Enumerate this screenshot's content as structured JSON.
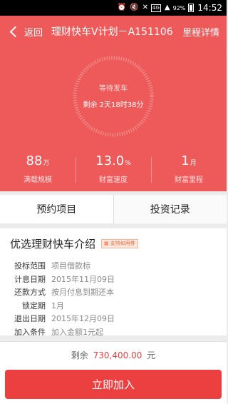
{
  "status_bar": {
    "battery_percent": "92%",
    "time": "14:52",
    "network": "4G",
    "icons": [
      "alarm-icon",
      "mute-icon",
      "x-icon",
      "network-icon",
      "signal-icon",
      "battery-icon"
    ]
  },
  "header": {
    "back_label": "返回",
    "title": "理财快车V计划－A151106",
    "title_right": "里程详情"
  },
  "ring": {
    "status": "等待发车",
    "remaining": "剩余 2天18时38分"
  },
  "stats": [
    {
      "value": "88",
      "unit": "万",
      "label": "满载规模"
    },
    {
      "value": "13.0",
      "unit": "%",
      "label": "财富速度"
    },
    {
      "value": "1",
      "unit": "月",
      "label": "财富里程"
    }
  ],
  "tabs": [
    {
      "label": "预约项目"
    },
    {
      "label": "投资记录"
    }
  ],
  "info": {
    "title": "优选理财快车介绍",
    "badge": "支持如用券",
    "rows": [
      {
        "label": "投标范围",
        "value": "项目借款标"
      },
      {
        "label": "计息日期",
        "value": "2015年11月09日"
      },
      {
        "label": "还款方式",
        "value": "按月付息到期还本"
      },
      {
        "label": "锁定期",
        "value": "1月"
      },
      {
        "label": "退出日期",
        "value": "2015年12月09日"
      },
      {
        "label": "加入条件",
        "value": "加入金额1元起"
      }
    ]
  },
  "footer": {
    "remain_prefix": "剩余",
    "remain_amount": "730,400.00",
    "remain_unit": "元",
    "join_button": "立即加入"
  },
  "colors": {
    "brand_red": "#ee5a5a",
    "button_red": "#ec4040",
    "amount_red": "#e9413f"
  }
}
